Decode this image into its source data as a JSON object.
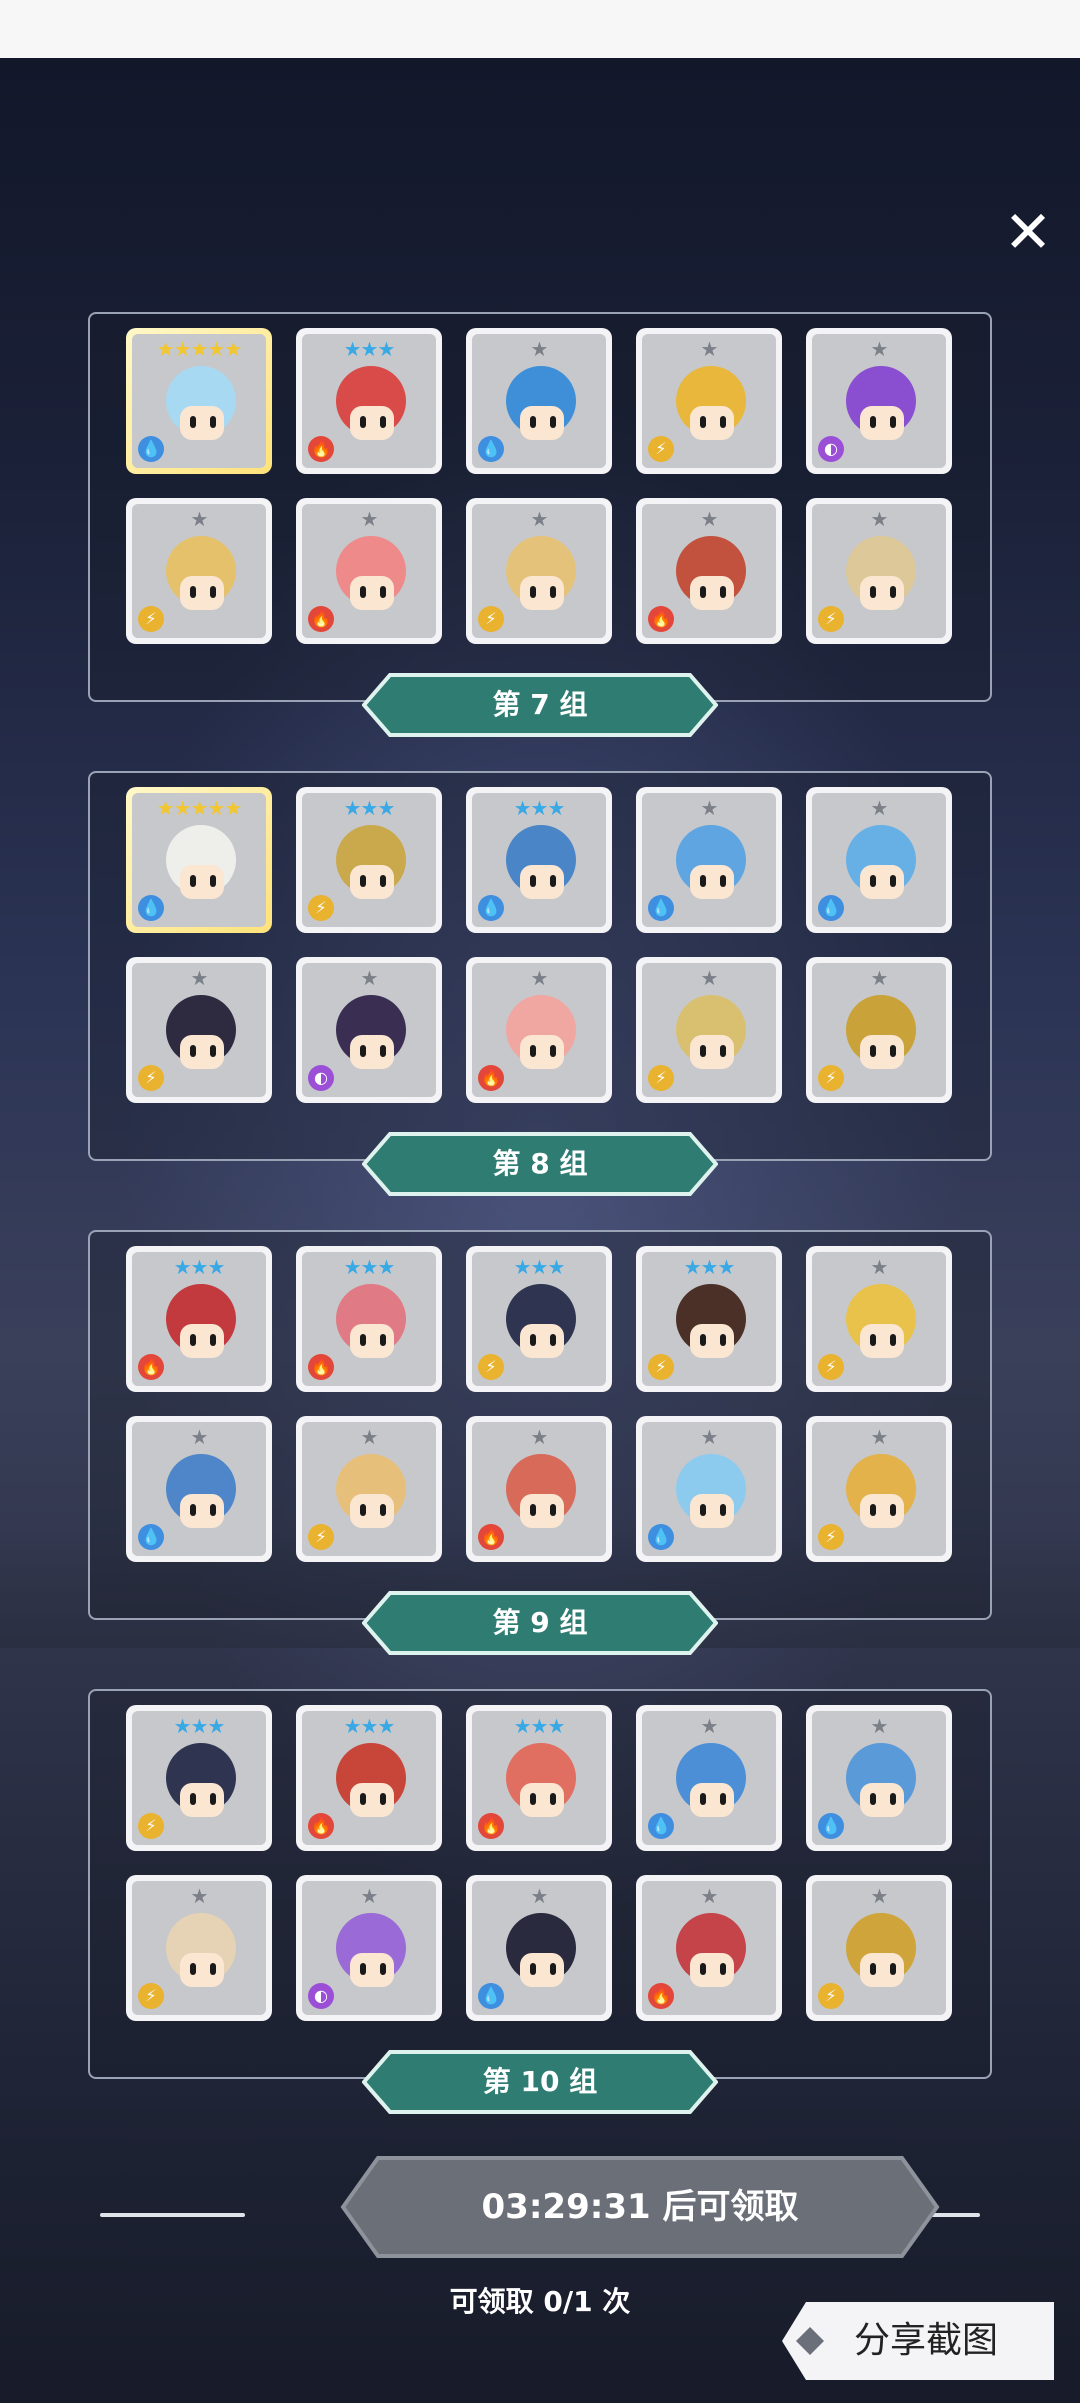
{
  "close_icon": "close-icon",
  "groups": [
    {
      "label": "第 7 组",
      "units": [
        {
          "stars": "★★★★★",
          "star_color": "#f2c630",
          "element": "water",
          "body": "#a7d9f2",
          "rare": true
        },
        {
          "stars": "★★★",
          "star_color": "#39a9e6",
          "element": "fire",
          "body": "#d94b48",
          "rare": false
        },
        {
          "stars": "★",
          "star_color": "#7b7f88",
          "element": "water",
          "body": "#3e8fd8",
          "rare": false
        },
        {
          "stars": "★",
          "star_color": "#7b7f88",
          "element": "thunder",
          "body": "#e8b73c",
          "rare": false
        },
        {
          "stars": "★",
          "star_color": "#7b7f88",
          "element": "dark",
          "body": "#8a4fd0",
          "rare": false
        },
        {
          "stars": "★",
          "star_color": "#7b7f88",
          "element": "thunder",
          "body": "#e5c16b",
          "rare": false
        },
        {
          "stars": "★",
          "star_color": "#7b7f88",
          "element": "fire",
          "body": "#ee8a8a",
          "rare": false
        },
        {
          "stars": "★",
          "star_color": "#7b7f88",
          "element": "thunder",
          "body": "#e4c27a",
          "rare": false
        },
        {
          "stars": "★",
          "star_color": "#7b7f88",
          "element": "fire",
          "body": "#c2523e",
          "rare": false
        },
        {
          "stars": "★",
          "star_color": "#7b7f88",
          "element": "thunder",
          "body": "#dcc898",
          "rare": false
        }
      ]
    },
    {
      "label": "第 8 组",
      "units": [
        {
          "stars": "★★★★★",
          "star_color": "#f2c630",
          "element": "water",
          "body": "#eeeeea",
          "rare": true
        },
        {
          "stars": "★★★",
          "star_color": "#39a9e6",
          "element": "thunder",
          "body": "#caa94c",
          "rare": false
        },
        {
          "stars": "★★★",
          "star_color": "#39a9e6",
          "element": "water",
          "body": "#4a85c8",
          "rare": false
        },
        {
          "stars": "★",
          "star_color": "#7b7f88",
          "element": "water",
          "body": "#5fa5e2",
          "rare": false
        },
        {
          "stars": "★",
          "star_color": "#7b7f88",
          "element": "water",
          "body": "#66b0e6",
          "rare": false
        },
        {
          "stars": "★",
          "star_color": "#7b7f88",
          "element": "thunder",
          "body": "#2e2a40",
          "rare": false
        },
        {
          "stars": "★",
          "star_color": "#7b7f88",
          "element": "dark",
          "body": "#3a2f52",
          "rare": false
        },
        {
          "stars": "★",
          "star_color": "#7b7f88",
          "element": "fire",
          "body": "#f0a7a2",
          "rare": false
        },
        {
          "stars": "★",
          "star_color": "#7b7f88",
          "element": "thunder",
          "body": "#d9c070",
          "rare": false
        },
        {
          "stars": "★",
          "star_color": "#7b7f88",
          "element": "thunder",
          "body": "#c9a33a",
          "rare": false
        }
      ]
    },
    {
      "label": "第 9 组",
      "units": [
        {
          "stars": "★★★",
          "star_color": "#39a9e6",
          "element": "fire",
          "body": "#c23a3e",
          "rare": false
        },
        {
          "stars": "★★★",
          "star_color": "#39a9e6",
          "element": "fire",
          "body": "#e07a84",
          "rare": false
        },
        {
          "stars": "★★★",
          "star_color": "#39a9e6",
          "element": "thunder",
          "body": "#2f3450",
          "rare": false
        },
        {
          "stars": "★★★",
          "star_color": "#39a9e6",
          "element": "thunder",
          "body": "#4b3028",
          "rare": false
        },
        {
          "stars": "★",
          "star_color": "#7b7f88",
          "element": "thunder",
          "body": "#e8c24a",
          "rare": false
        },
        {
          "stars": "★",
          "star_color": "#7b7f88",
          "element": "water",
          "body": "#4e86c9",
          "rare": false
        },
        {
          "stars": "★",
          "star_color": "#7b7f88",
          "element": "thunder",
          "body": "#e6c07a",
          "rare": false
        },
        {
          "stars": "★",
          "star_color": "#7b7f88",
          "element": "fire",
          "body": "#d86a5a",
          "rare": false
        },
        {
          "stars": "★",
          "star_color": "#7b7f88",
          "element": "water",
          "body": "#8ccbee",
          "rare": false
        },
        {
          "stars": "★",
          "star_color": "#7b7f88",
          "element": "thunder",
          "body": "#e3b24a",
          "rare": false
        }
      ]
    },
    {
      "label": "第 10 组",
      "units": [
        {
          "stars": "★★★",
          "star_color": "#39a9e6",
          "element": "thunder",
          "body": "#2f3450",
          "rare": false
        },
        {
          "stars": "★★★",
          "star_color": "#39a9e6",
          "element": "fire",
          "body": "#c8453a",
          "rare": false
        },
        {
          "stars": "★★★",
          "star_color": "#39a9e6",
          "element": "fire",
          "body": "#e06f62",
          "rare": false
        },
        {
          "stars": "★",
          "star_color": "#7b7f88",
          "element": "water",
          "body": "#4c8fd6",
          "rare": false
        },
        {
          "stars": "★",
          "star_color": "#7b7f88",
          "element": "water",
          "body": "#5a9ad8",
          "rare": false
        },
        {
          "stars": "★",
          "star_color": "#7b7f88",
          "element": "thunder",
          "body": "#e6d2b4",
          "rare": false
        },
        {
          "stars": "★",
          "star_color": "#7b7f88",
          "element": "dark",
          "body": "#9a6ad6",
          "rare": false
        },
        {
          "stars": "★",
          "star_color": "#7b7f88",
          "element": "water",
          "body": "#2a2a3e",
          "rare": false
        },
        {
          "stars": "★",
          "star_color": "#7b7f88",
          "element": "fire",
          "body": "#c4444a",
          "rare": false
        },
        {
          "stars": "★",
          "star_color": "#7b7f88",
          "element": "thunder",
          "body": "#cfa43a",
          "rare": false
        }
      ]
    }
  ],
  "element_colors": {
    "water": "#3f8fe0",
    "fire": "#e2473a",
    "thunder": "#e9b22f",
    "dark": "#9b4fd6"
  },
  "element_glyphs": {
    "water": "💧",
    "fire": "🔥",
    "thunder": "⚡",
    "dark": "◐"
  },
  "claim": {
    "button_text": "03:29:31 后可领取",
    "count_text": "可领取 0/1 次"
  },
  "share": {
    "label": "分享截图"
  },
  "colors": {
    "label_teal": "#2f7d72",
    "label_border": "#dff3ee",
    "claim_gray": "#6b6f78"
  }
}
